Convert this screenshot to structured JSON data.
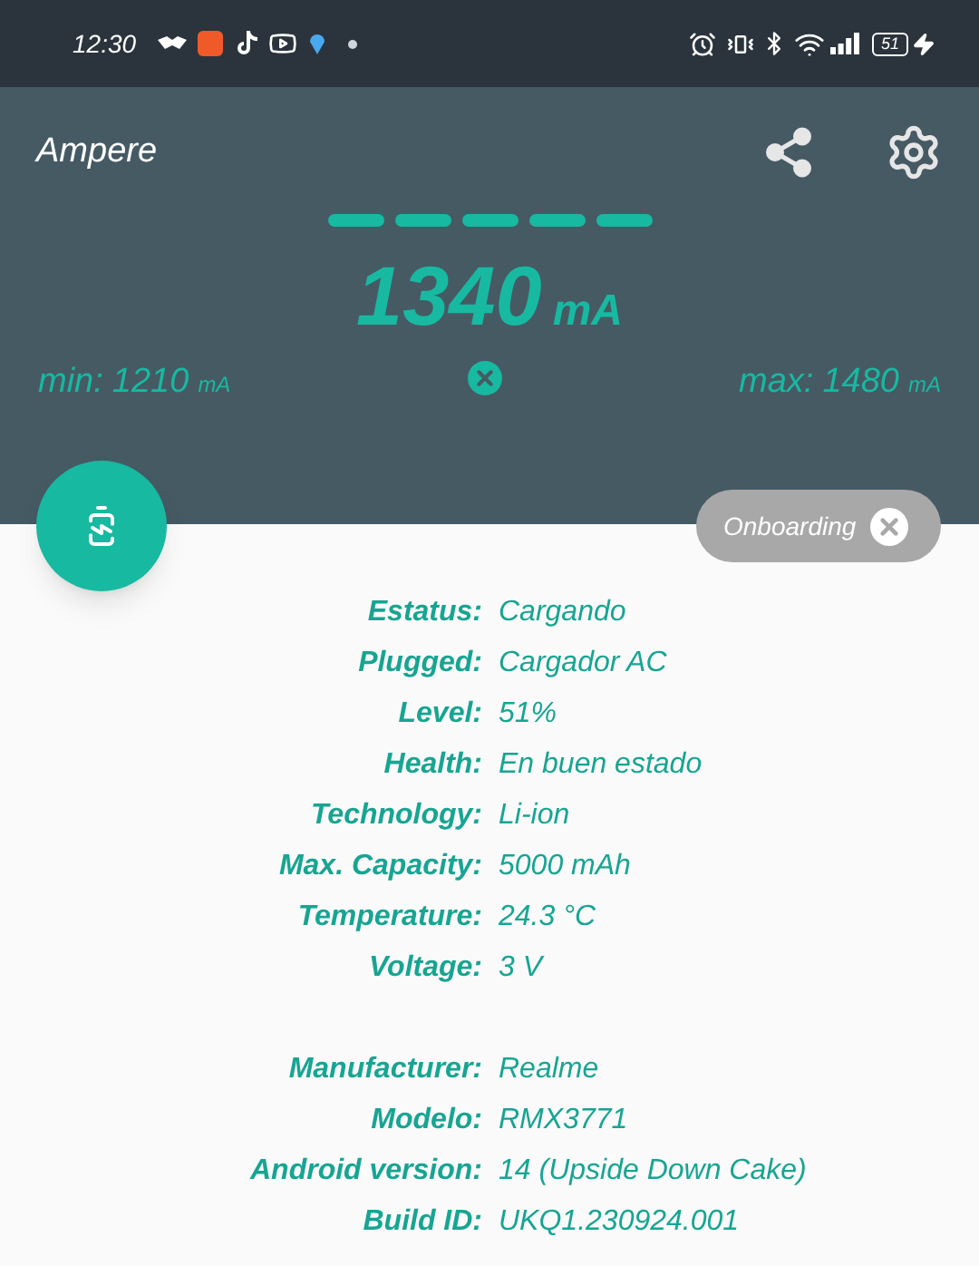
{
  "status_bar": {
    "time": "12:30",
    "battery": "51"
  },
  "app_bar": {
    "title": "Ampere"
  },
  "meter": {
    "current": "1340",
    "unit": "mA",
    "min_label": "min:",
    "min_value": "1210",
    "min_unit": "mA",
    "max_label": "max:",
    "max_value": "1480",
    "max_unit": "mA"
  },
  "chip": {
    "label": "Onboarding"
  },
  "groups": [
    [
      {
        "label": "Estatus:",
        "value": "Cargando"
      },
      {
        "label": "Plugged:",
        "value": "Cargador AC"
      },
      {
        "label": "Level:",
        "value": "51%"
      },
      {
        "label": "Health:",
        "value": "En buen estado"
      },
      {
        "label": "Technology:",
        "value": "Li-ion"
      },
      {
        "label": "Max. Capacity:",
        "value": "5000 mAh"
      },
      {
        "label": "Temperature:",
        "value": "24.3 °C"
      },
      {
        "label": "Voltage:",
        "value": "3 V"
      }
    ],
    [
      {
        "label": "Manufacturer:",
        "value": "Realme"
      },
      {
        "label": "Modelo:",
        "value": "RMX3771"
      },
      {
        "label": "Android version:",
        "value": "14 (Upside Down Cake)"
      },
      {
        "label": "Build ID:",
        "value": "UKQ1.230924.001"
      }
    ]
  ]
}
